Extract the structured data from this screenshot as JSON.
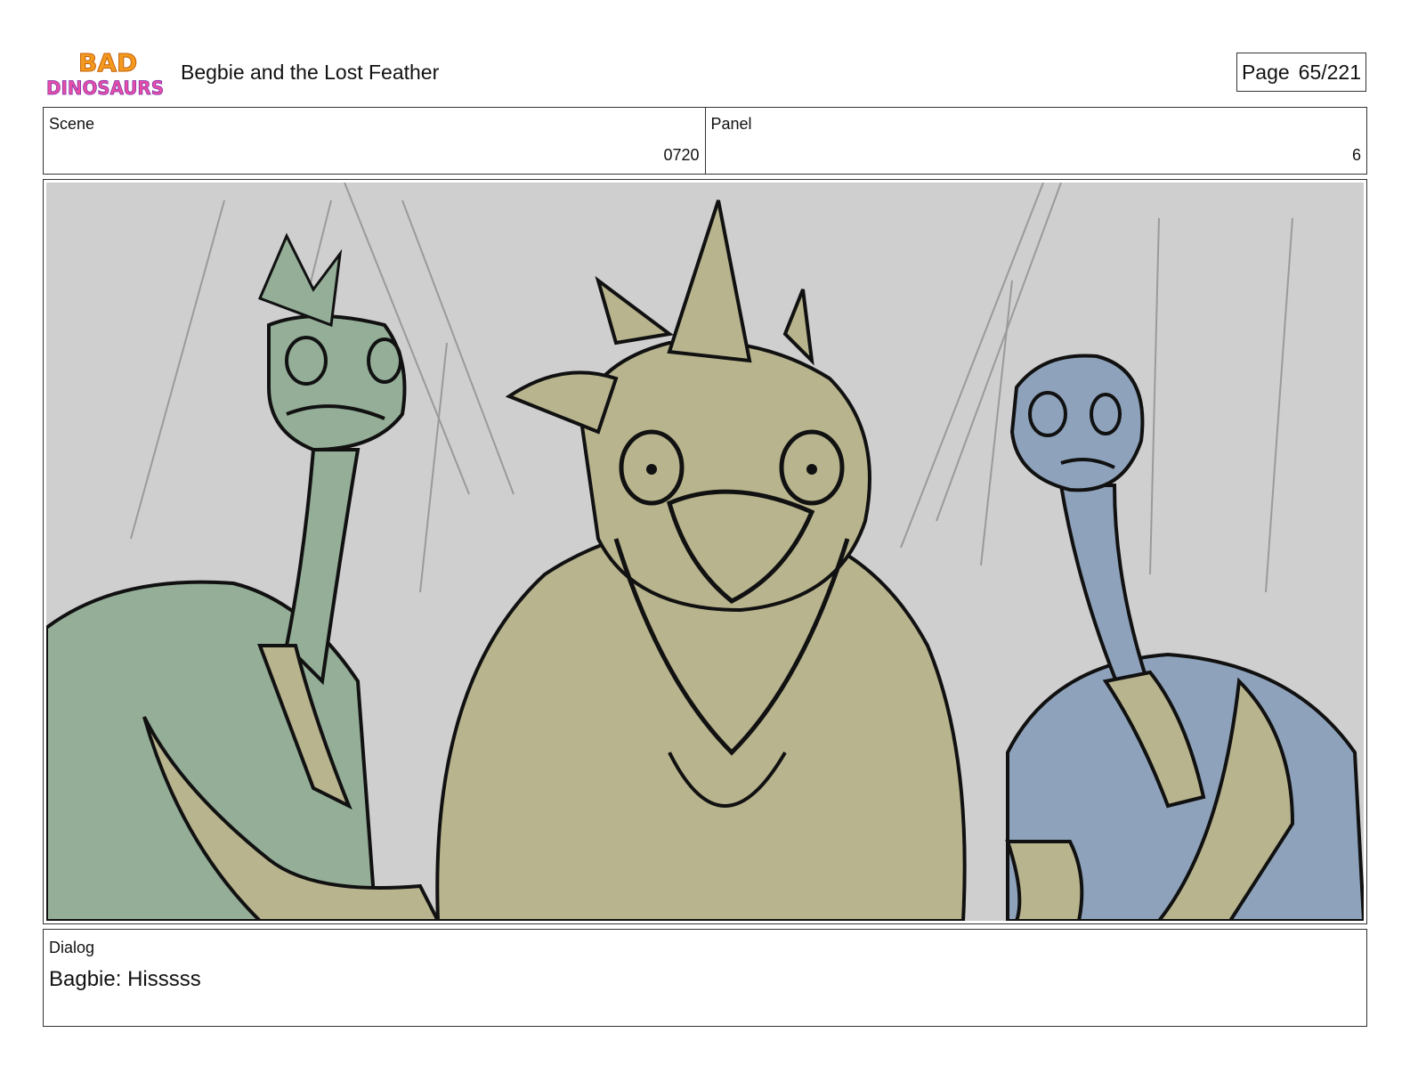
{
  "header": {
    "logo_text_line1": "BAD",
    "logo_text_line2": "DINOSAURS",
    "title": "Begbie and the Lost Feather",
    "page_label": "Page",
    "page_number": "65/221"
  },
  "info": {
    "scene_label": "Scene",
    "scene_value": "0720",
    "panel_label": "Panel",
    "panel_value": "6"
  },
  "panel_image": {
    "background_color": "#cfcfcf",
    "characters": [
      "green-dinosaur",
      "tan-dinosaur-begbie",
      "blue-dinosaur"
    ],
    "colors": {
      "green": "#94ae98",
      "tan": "#b8b48e",
      "blue": "#8ea3bb",
      "ink": "#111111"
    }
  },
  "dialog": {
    "label": "Dialog",
    "text": "Bagbie: Hisssss"
  }
}
